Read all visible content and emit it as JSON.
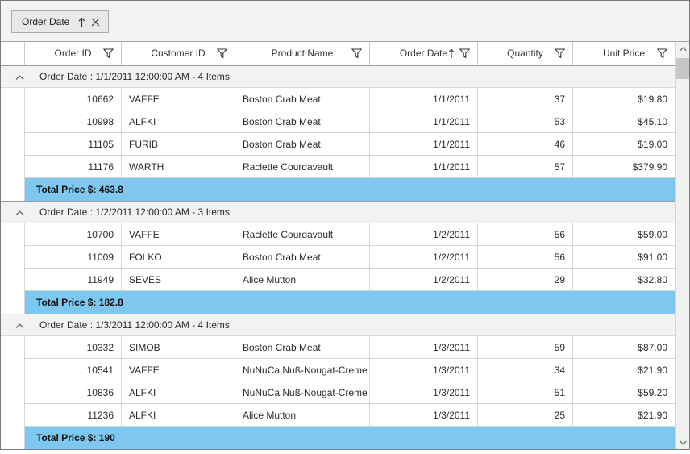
{
  "group_drop_area": {
    "chip": {
      "label": "Order Date",
      "sort_direction": "ascending"
    }
  },
  "columns": [
    {
      "label": "Order ID",
      "filter": true,
      "sorted": false
    },
    {
      "label": "Customer ID",
      "filter": true,
      "sorted": false
    },
    {
      "label": "Product Name",
      "filter": true,
      "sorted": false
    },
    {
      "label": "Order Date",
      "filter": true,
      "sorted": "ascending"
    },
    {
      "label": "Quantity",
      "filter": true,
      "sorted": false
    },
    {
      "label": "Unit Price",
      "filter": true,
      "sorted": false
    }
  ],
  "groups": [
    {
      "caption": "Order Date : 1/1/2011 12:00:00 AM - 4 Items",
      "rows": [
        {
          "order_id": "10662",
          "customer_id": "VAFFE",
          "product_name": "Boston Crab Meat",
          "order_date": "1/1/2011",
          "quantity": "37",
          "unit_price": "$19.80"
        },
        {
          "order_id": "10998",
          "customer_id": "ALFKI",
          "product_name": "Boston Crab Meat",
          "order_date": "1/1/2011",
          "quantity": "53",
          "unit_price": "$45.10"
        },
        {
          "order_id": "11105",
          "customer_id": "FURIB",
          "product_name": "Boston Crab Meat",
          "order_date": "1/1/2011",
          "quantity": "46",
          "unit_price": "$19.00"
        },
        {
          "order_id": "11176",
          "customer_id": "WARTH",
          "product_name": "Raclette Courdavault",
          "order_date": "1/1/2011",
          "quantity": "57",
          "unit_price": "$379.90"
        }
      ],
      "summary": "Total Price $: 463.8"
    },
    {
      "caption": "Order Date : 1/2/2011 12:00:00 AM - 3 Items",
      "rows": [
        {
          "order_id": "10700",
          "customer_id": "VAFFE",
          "product_name": "Raclette Courdavault",
          "order_date": "1/2/2011",
          "quantity": "56",
          "unit_price": "$59.00"
        },
        {
          "order_id": "11009",
          "customer_id": "FOLKO",
          "product_name": "Boston Crab Meat",
          "order_date": "1/2/2011",
          "quantity": "56",
          "unit_price": "$91.00"
        },
        {
          "order_id": "11949",
          "customer_id": "SEVES",
          "product_name": "Alice Mutton",
          "order_date": "1/2/2011",
          "quantity": "29",
          "unit_price": "$32.80"
        }
      ],
      "summary": "Total Price $: 182.8"
    },
    {
      "caption": "Order Date : 1/3/2011 12:00:00 AM - 4 Items",
      "rows": [
        {
          "order_id": "10332",
          "customer_id": "SIMOB",
          "product_name": "Boston Crab Meat",
          "order_date": "1/3/2011",
          "quantity": "59",
          "unit_price": "$87.00"
        },
        {
          "order_id": "10541",
          "customer_id": "VAFFE",
          "product_name": "NuNuCa Nuß-Nougat-Creme",
          "order_date": "1/3/2011",
          "quantity": "34",
          "unit_price": "$21.90"
        },
        {
          "order_id": "10836",
          "customer_id": "ALFKI",
          "product_name": "NuNuCa Nuß-Nougat-Creme",
          "order_date": "1/3/2011",
          "quantity": "51",
          "unit_price": "$59.20"
        },
        {
          "order_id": "11236",
          "customer_id": "ALFKI",
          "product_name": "Alice Mutton",
          "order_date": "1/3/2011",
          "quantity": "25",
          "unit_price": "$21.90"
        }
      ],
      "summary": "Total Price $: 190"
    }
  ],
  "icons": {
    "filter": "funnel-outline",
    "sort_ascending": "arrow-up",
    "remove_group": "x-close",
    "collapse_group": "chevron-up",
    "scroll_up": "chevron-up",
    "scroll_down": "chevron-down"
  },
  "colors": {
    "summary_row_bg": "#7EC8F0",
    "caption_row_bg": "#F2F2F2",
    "drop_area_bg": "#F3F3F3",
    "row_border": "#D6D6D6",
    "outer_border": "#7A7A7A"
  }
}
